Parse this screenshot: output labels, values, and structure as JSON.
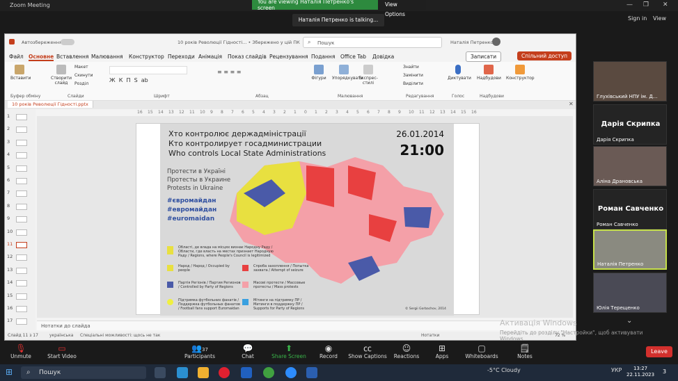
{
  "zoom": {
    "title": "Zoom Meeting",
    "share_banner": "You are viewing Наталія Петренко's screen",
    "view_options": "View Options",
    "talking": "Наталія Петренко is talking...",
    "sign_in": "Sign in",
    "view": "View"
  },
  "ppt": {
    "autosave": "Автозбереження",
    "doc_title": "10 років Революції Гідності... • Збережено у цій ПК",
    "search": "Пошук",
    "user": "Наталія Петренко",
    "menu": [
      "Файл",
      "Основне",
      "Вставлення",
      "Малювання",
      "Конструктор",
      "Переходи",
      "Анімація",
      "Показ слайдів",
      "Рецензування",
      "Подання",
      "Office Tab",
      "Довідка"
    ],
    "record": "Записати",
    "share": "Спільний доступ",
    "ribbon": {
      "paste": "Вставити",
      "create_slide": "Створити слайд",
      "layout": "Макет",
      "reset": "Скинути",
      "section": "Розділ",
      "find": "Знайти",
      "replace": "Замінити",
      "select": "Виділити",
      "shapes": "Фігури",
      "arrange": "Упорядкувати",
      "quick_styles": "Експрес-стилі",
      "dictate": "Диктувати",
      "designer_ideas": "Надбудови",
      "designer": "Конструктор",
      "groups": {
        "clipboard": "Буфер обміну",
        "slides": "Слайди",
        "font": "Шрифт",
        "paragraph": "Абзац",
        "drawing": "Малювання",
        "editing": "Редагування",
        "voice": "Голос",
        "addins": "Надбудови"
      }
    },
    "tab": "10 років Революції Гідності.pptx",
    "ruler": [
      "16",
      "15",
      "14",
      "13",
      "12",
      "11",
      "10",
      "9",
      "8",
      "7",
      "6",
      "5",
      "4",
      "3",
      "2",
      "1",
      "0",
      "1",
      "2",
      "3",
      "4",
      "5",
      "6",
      "7",
      "8",
      "9",
      "10",
      "11",
      "12",
      "13",
      "14",
      "15",
      "16"
    ],
    "slide_numbers": [
      "1",
      "2",
      "3",
      "4",
      "5",
      "6",
      "7",
      "8",
      "9",
      "10",
      "11",
      "12",
      "13",
      "14",
      "15",
      "16",
      "17"
    ],
    "notes": "Нотатки до слайда",
    "status": {
      "slide": "Слайд 11 з 17",
      "lang": "українська",
      "access": "Спеціальні можливості: щось не так",
      "notes_btn": "Нотатки",
      "zoom": "72 %"
    }
  },
  "slide": {
    "title_uk": "Хто контролює держадміністрації",
    "title_ru": "Кто контролирует госадминистрации",
    "title_en": "Who controls Local State Administrations",
    "date": "26.01.2014",
    "time": "21:00",
    "protests": [
      "Протести в Україні",
      "Протесты в Украине",
      "Protests in Ukraine"
    ],
    "hashtags": [
      "#євромайдан",
      "#евромайдан",
      "#euromaidan"
    ],
    "legend_top": "Області, де влада на місцях визнає Народну Раду / Области, где власть на местах признает Народную Раду / Regions, where People's Council is legitimized",
    "legend": [
      {
        "text": "Народ / Народ / Occupied by people",
        "color": "#e8e040"
      },
      {
        "text": "Спроба захоплення / Попытка захвата / Attempt of seizure",
        "color": "#e84040"
      },
      {
        "text": "Партія Регіонів / Партия Регионов / Controlled by Party of Regions",
        "color": "#4a5aa8"
      },
      {
        "text": "Масові протести / Массовые протесты / Mass protests",
        "color": "#f4a0a8"
      },
      {
        "text": "Підтримка футбольних фанатів / Поддержка футбольных фанатов / Football fans support Euromaidan",
        "color": "#f0f040"
      },
      {
        "text": "Мітинги на підтримку ПР / Митинги в поддержку ПР / Supports for Party of Regions",
        "color": "#3aa0e0"
      }
    ],
    "credit": "© Sergii Gorbachov, 2014"
  },
  "gallery": [
    {
      "name": "Глухівський НПУ ім. Д..."
    },
    {
      "big": "Дарія Скрипка",
      "name": "Дарія Скрипка"
    },
    {
      "name": "Аліна Драновська"
    },
    {
      "big": "Роман Савченко",
      "name": "Роман Савченко"
    },
    {
      "name": "Наталія Петренко"
    },
    {
      "name": "Юлія Терещенко"
    }
  ],
  "watermark": {
    "line1": "Активація Windows",
    "line2": "Перейдіть до розділу \"Настройки\", щоб активувати Windows."
  },
  "toolbar": {
    "unmute": "Unmute",
    "start_video": "Start Video",
    "participants": "Participants",
    "participants_count": "37",
    "chat": "Chat",
    "share": "Share Screen",
    "record": "Record",
    "captions": "Show Captions",
    "reactions": "Reactions",
    "apps": "Apps",
    "whiteboards": "Whiteboards",
    "notes": "Notes",
    "leave": "Leave"
  },
  "taskbar": {
    "search": "Пошук",
    "weather": "-5°C  Cloudy",
    "lang": "УКР",
    "time": "13:27",
    "date": "22.11.2023",
    "badge": "3"
  }
}
